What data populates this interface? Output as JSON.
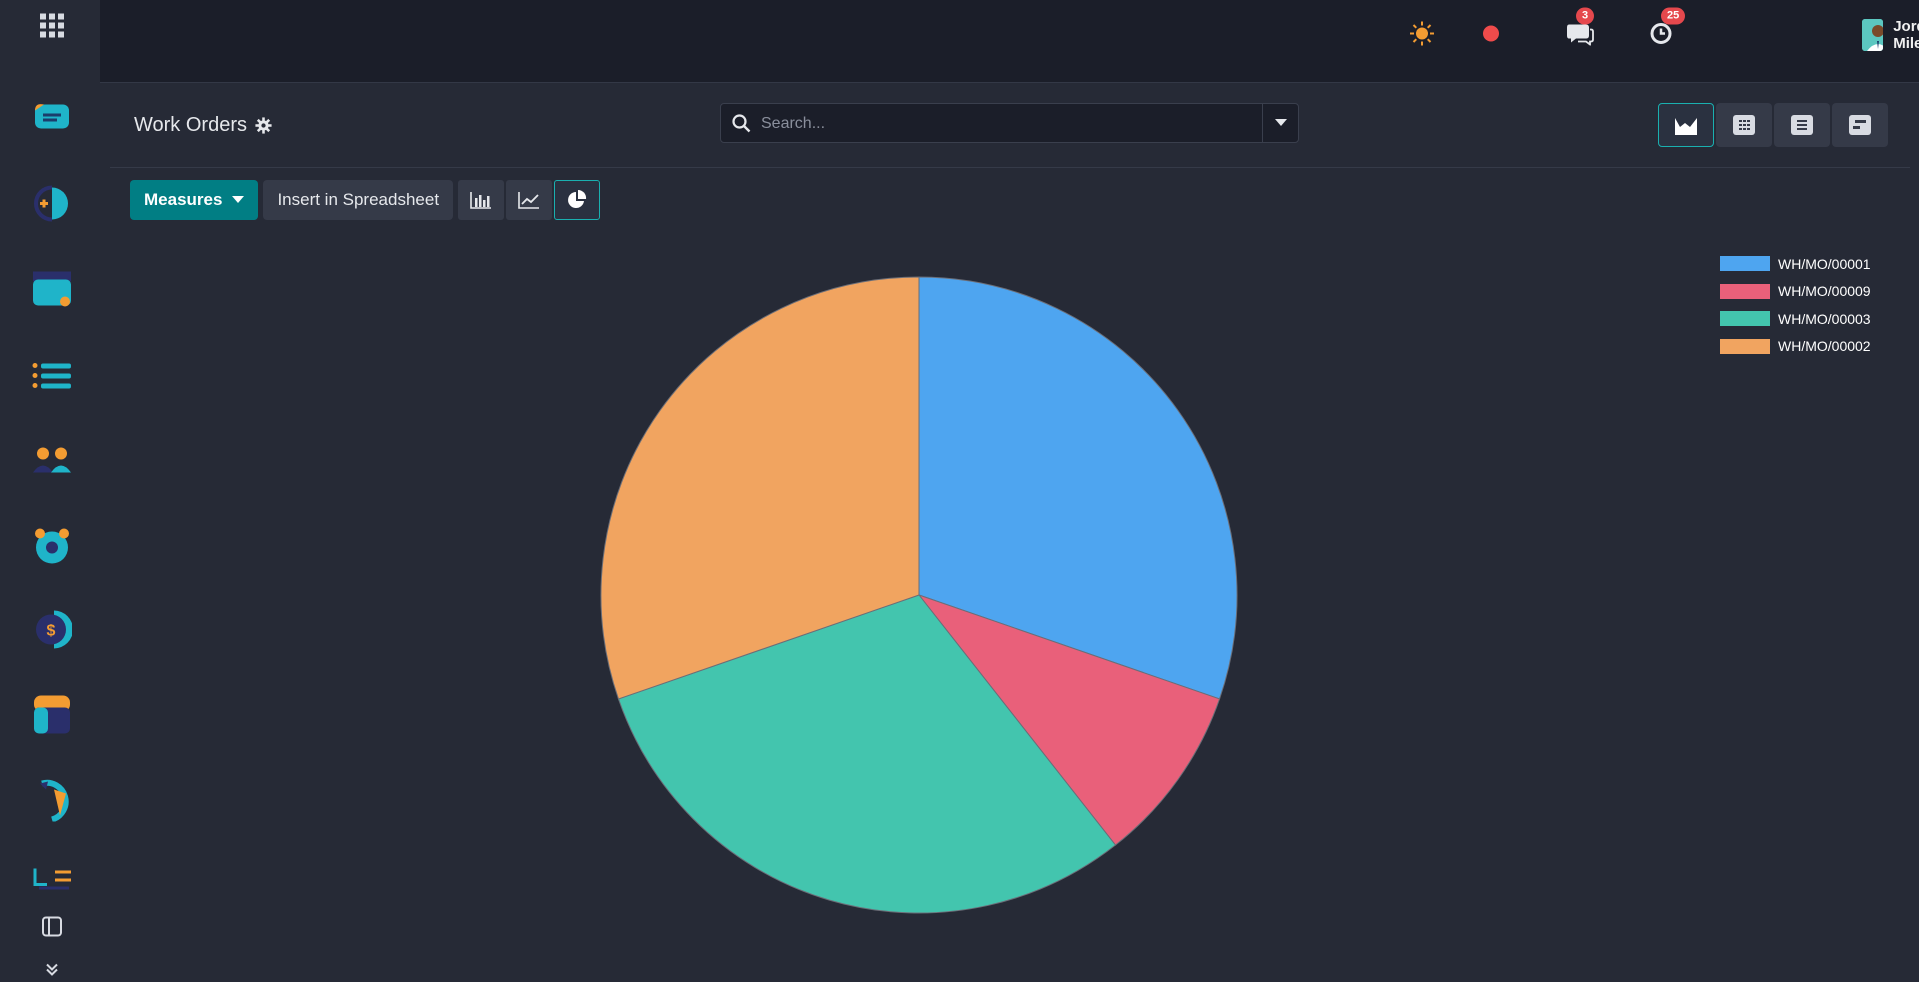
{
  "topbar": {
    "messages_count": "3",
    "activities_count": "25",
    "user_name": "Jordan Miles"
  },
  "control": {
    "title": "Work Orders",
    "search_placeholder": "Search..."
  },
  "toolbar": {
    "measures_label": "Measures",
    "insert_label": "Insert in Spreadsheet"
  },
  "colors": {
    "accent": "#017e84",
    "active_border": "#1ab0b0"
  },
  "chart_data": {
    "type": "pie",
    "labels": [
      "WH/MO/00001",
      "WH/MO/00009",
      "WH/MO/00003",
      "WH/MO/00002"
    ],
    "values": [
      30.3,
      9.1,
      30.3,
      30.3
    ],
    "colors": [
      "#4ea5f0",
      "#e9607a",
      "#43c5ae",
      "#f1a460"
    ],
    "legend_position": "top-right"
  }
}
